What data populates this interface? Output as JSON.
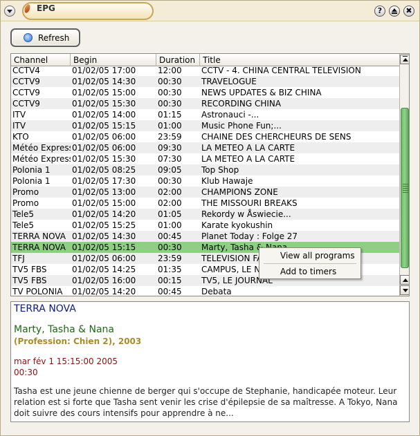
{
  "window": {
    "title": "EPG",
    "help_glyph": "?",
    "close_glyph": "✖"
  },
  "toolbar": {
    "refresh_label": "Refresh"
  },
  "table": {
    "columns": [
      "Channel",
      "Begin",
      "Duration",
      "Title"
    ],
    "rows": [
      [
        "CCTV4",
        "01/02/05  17:00",
        "12:00",
        "CCTV - 4. CHINA CENTRAL TELEVISION"
      ],
      [
        "CCTV9",
        "01/02/05  14:30",
        "00:30",
        "TRAVELOGUE"
      ],
      [
        "CCTV9",
        "01/02/05  15:00",
        "00:30",
        "NEWS UPDATES & BIZ CHINA"
      ],
      [
        "CCTV9",
        "01/02/05  15:30",
        "00:30",
        "RECORDING CHINA"
      ],
      [
        "ITV",
        "01/02/05  14:00",
        "01:15",
        "Astronauci -..."
      ],
      [
        "ITV",
        "01/02/05  15:15",
        "01:00",
        "Music Phone Fun;..."
      ],
      [
        "KTO",
        "01/02/05  06:00",
        "23:59",
        "CHAINE DES CHERCHEURS DE SENS"
      ],
      [
        "Météo Express",
        "01/02/05  06:00",
        "09:30",
        "LA METEO A LA CARTE"
      ],
      [
        "Météo Express",
        "01/02/05  15:30",
        "07:30",
        "LA METEO A LA CARTE"
      ],
      [
        "Polonia 1",
        "01/02/05  08:25",
        "09:05",
        "Top Shop"
      ],
      [
        "Polonia 1",
        "01/02/05  17:30",
        "00:30",
        "Klub Hawaje"
      ],
      [
        "Promo",
        "01/02/05  13:00",
        "02:00",
        "CHAMPIONS ZONE"
      ],
      [
        "Promo",
        "01/02/05  15:00",
        "02:00",
        "THE MISSOURI BREAKS"
      ],
      [
        "Tele5",
        "01/02/05  14:20",
        "01:05",
        "Rekordy w Åswiecie..."
      ],
      [
        "Tele5",
        "01/02/05  15:25",
        "01:00",
        "Karate kyokushin"
      ],
      [
        "TERRA NOVA",
        "01/02/05  14:30",
        "00:45",
        "Planet Today : Folge 27"
      ],
      [
        "TERRA NOVA",
        "01/02/05  15:15",
        "00:30",
        "Marty, Tasha & Nana"
      ],
      [
        "TFJ",
        "01/02/05  06:00",
        "23:59",
        "TELEVISION FA"
      ],
      [
        "TV5 FBS",
        "01/02/05  14:25",
        "01:35",
        "CAMPUS, LE N"
      ],
      [
        "TV5 FBS",
        "01/02/05  16:00",
        "00:15",
        "TV5, LE JOURNAL"
      ],
      [
        "TV POLONIA",
        "01/02/05  14:20",
        "00:45",
        "Debata"
      ]
    ],
    "selected_row": 16
  },
  "context_menu": {
    "items": [
      "View all programs",
      "Add to timers"
    ]
  },
  "details": {
    "channel": "TERRA NOVA",
    "title": "Marty, Tasha & Nana",
    "subtitle": "(Profession: Chien 2), 2003",
    "datetime": "mar fév 1 15:15:00 2005",
    "duration": "00:30",
    "description": "Tasha est une jeune chienne de berger qui s'occupe de Stephanie, handicapée moteur. Leur relation est si forte que Tasha sent venir les crise d'épilepsie de sa maîtresse. A Tokyo, Nana doit suivre des cours intensifs pour apprendre à ne..."
  },
  "colors": {
    "selected_row": "#8ecf84",
    "channel_text": "#0a1a8c",
    "title_text": "#1a6b10",
    "subtitle_text": "#a88c2a",
    "time_text": "#8c1010",
    "scroll_thumb": "#7fc679"
  }
}
